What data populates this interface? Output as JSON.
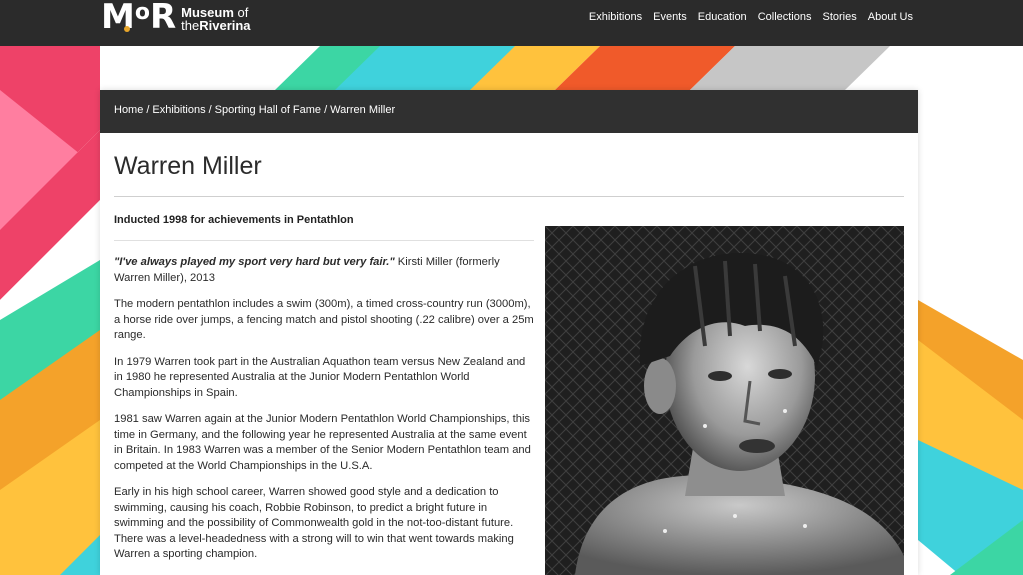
{
  "logo": {
    "mark": "MoR",
    "line1": "Museum",
    "line1_suffix": "of",
    "line2_prefix": "the",
    "line2": "Riverina"
  },
  "nav": {
    "items": [
      "Exhibitions",
      "Events",
      "Education",
      "Collections",
      "Stories",
      "About Us"
    ]
  },
  "breadcrumb": {
    "items": [
      "Home",
      "Exhibitions",
      "Sporting Hall of Fame",
      "Warren Miller"
    ],
    "separator": "/"
  },
  "page": {
    "title": "Warren Miller",
    "inducted": "Inducted 1998 for achievements in Pentathlon",
    "quote": "\"I've always played my sport very hard but very fair.\"",
    "quote_attribution": " Kirsti Miller (formerly Warren Miller), 2013",
    "paragraphs": [
      "The modern pentathlon includes a swim (300m), a timed cross-country run (3000m), a horse ride over jumps, a fencing match and pistol shooting (.22 calibre) over a 25m range.",
      "In 1979 Warren took part in the Australian Aquathon team versus New Zealand and in 1980 he represented Australia at the Junior Modern Pentathlon World Championships in Spain.",
      "1981 saw Warren again at the Junior Modern Pentathlon World Championships, this time in Germany, and the following year he represented Australia at the same event in Britain.  In 1983 Warren was a member of the Senior Modern Pentathlon team and competed at the World Championships in the U.S.A.",
      "Early in his high school career, Warren showed good style and a dedication to swimming, causing his coach, Robbie Robinson, to predict a bright future in swimming and the possibility of Commonwealth gold in the not-too-distant future.  There was a level-headedness with a strong will to win that went towards making Warren a sporting champion."
    ]
  },
  "colors": {
    "header_bg": "#2b2b2b",
    "breadcrumb_bg": "#303030",
    "accent_pink": "#ee4268",
    "accent_green": "#3cd6a4",
    "accent_cyan": "#3fd2dc",
    "accent_orange": "#f4a22a",
    "accent_red_orange": "#f05a2a",
    "accent_grey": "#c6c6c6",
    "accent_yellow": "#ffc23d"
  }
}
